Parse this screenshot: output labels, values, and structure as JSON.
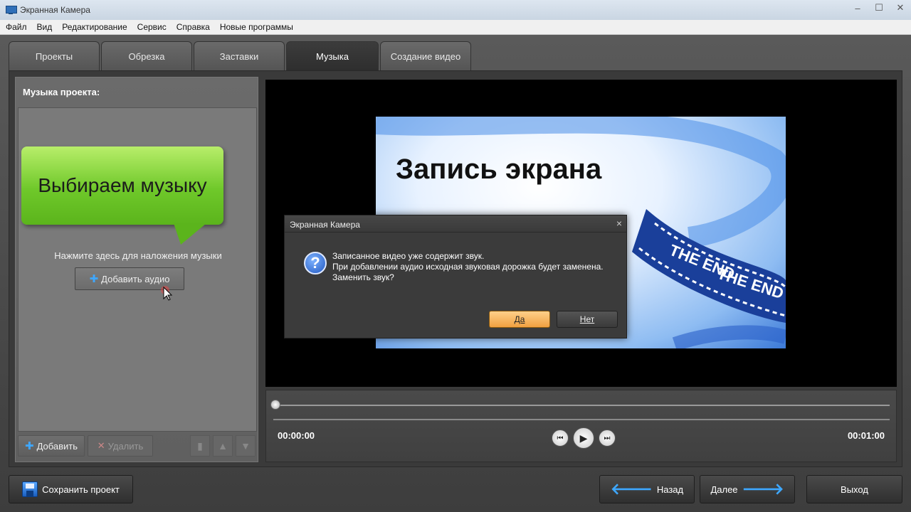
{
  "window": {
    "title": "Экранная Камера",
    "controls": [
      "–",
      "☐",
      "✕"
    ]
  },
  "menu": [
    "Файл",
    "Вид",
    "Редактирование",
    "Сервис",
    "Справка",
    "Новые программы"
  ],
  "tabs": [
    {
      "label": "Проекты",
      "active": false
    },
    {
      "label": "Обрезка",
      "active": false
    },
    {
      "label": "Заставки",
      "active": false
    },
    {
      "label": "Музыка",
      "active": true
    },
    {
      "label": "Создание видео",
      "active": false
    }
  ],
  "music_panel": {
    "heading": "Музыка проекта:",
    "bubble_text": "Выбираем музыку",
    "hint": "Нажмите здесь для наложения музыки",
    "add_audio_label": "Добавить аудио",
    "toolbar": {
      "add_label": "Добавить",
      "delete_label": "Удалить"
    }
  },
  "preview": {
    "video_title": "Запись экрана",
    "film_text": "THE END"
  },
  "player": {
    "current_time": "00:00:00",
    "total_time": "00:01:00",
    "position": 0
  },
  "dialog": {
    "title": "Экранная Камера",
    "close": "×",
    "message_lines": [
      "Записанное видео уже содержит звук.",
      "При добавлении аудио исходная звуковая дорожка будет заменена.",
      "Заменить звук?"
    ],
    "yes_label": "Да",
    "no_label": "Нет"
  },
  "footer": {
    "save_label": "Сохранить проект",
    "back_label": "Назад",
    "next_label": "Далее",
    "exit_label": "Выход"
  },
  "colors": {
    "accent_blue": "#3ea8ff",
    "bubble_green": "#6fc82a",
    "yes_button": "#f0a040"
  }
}
